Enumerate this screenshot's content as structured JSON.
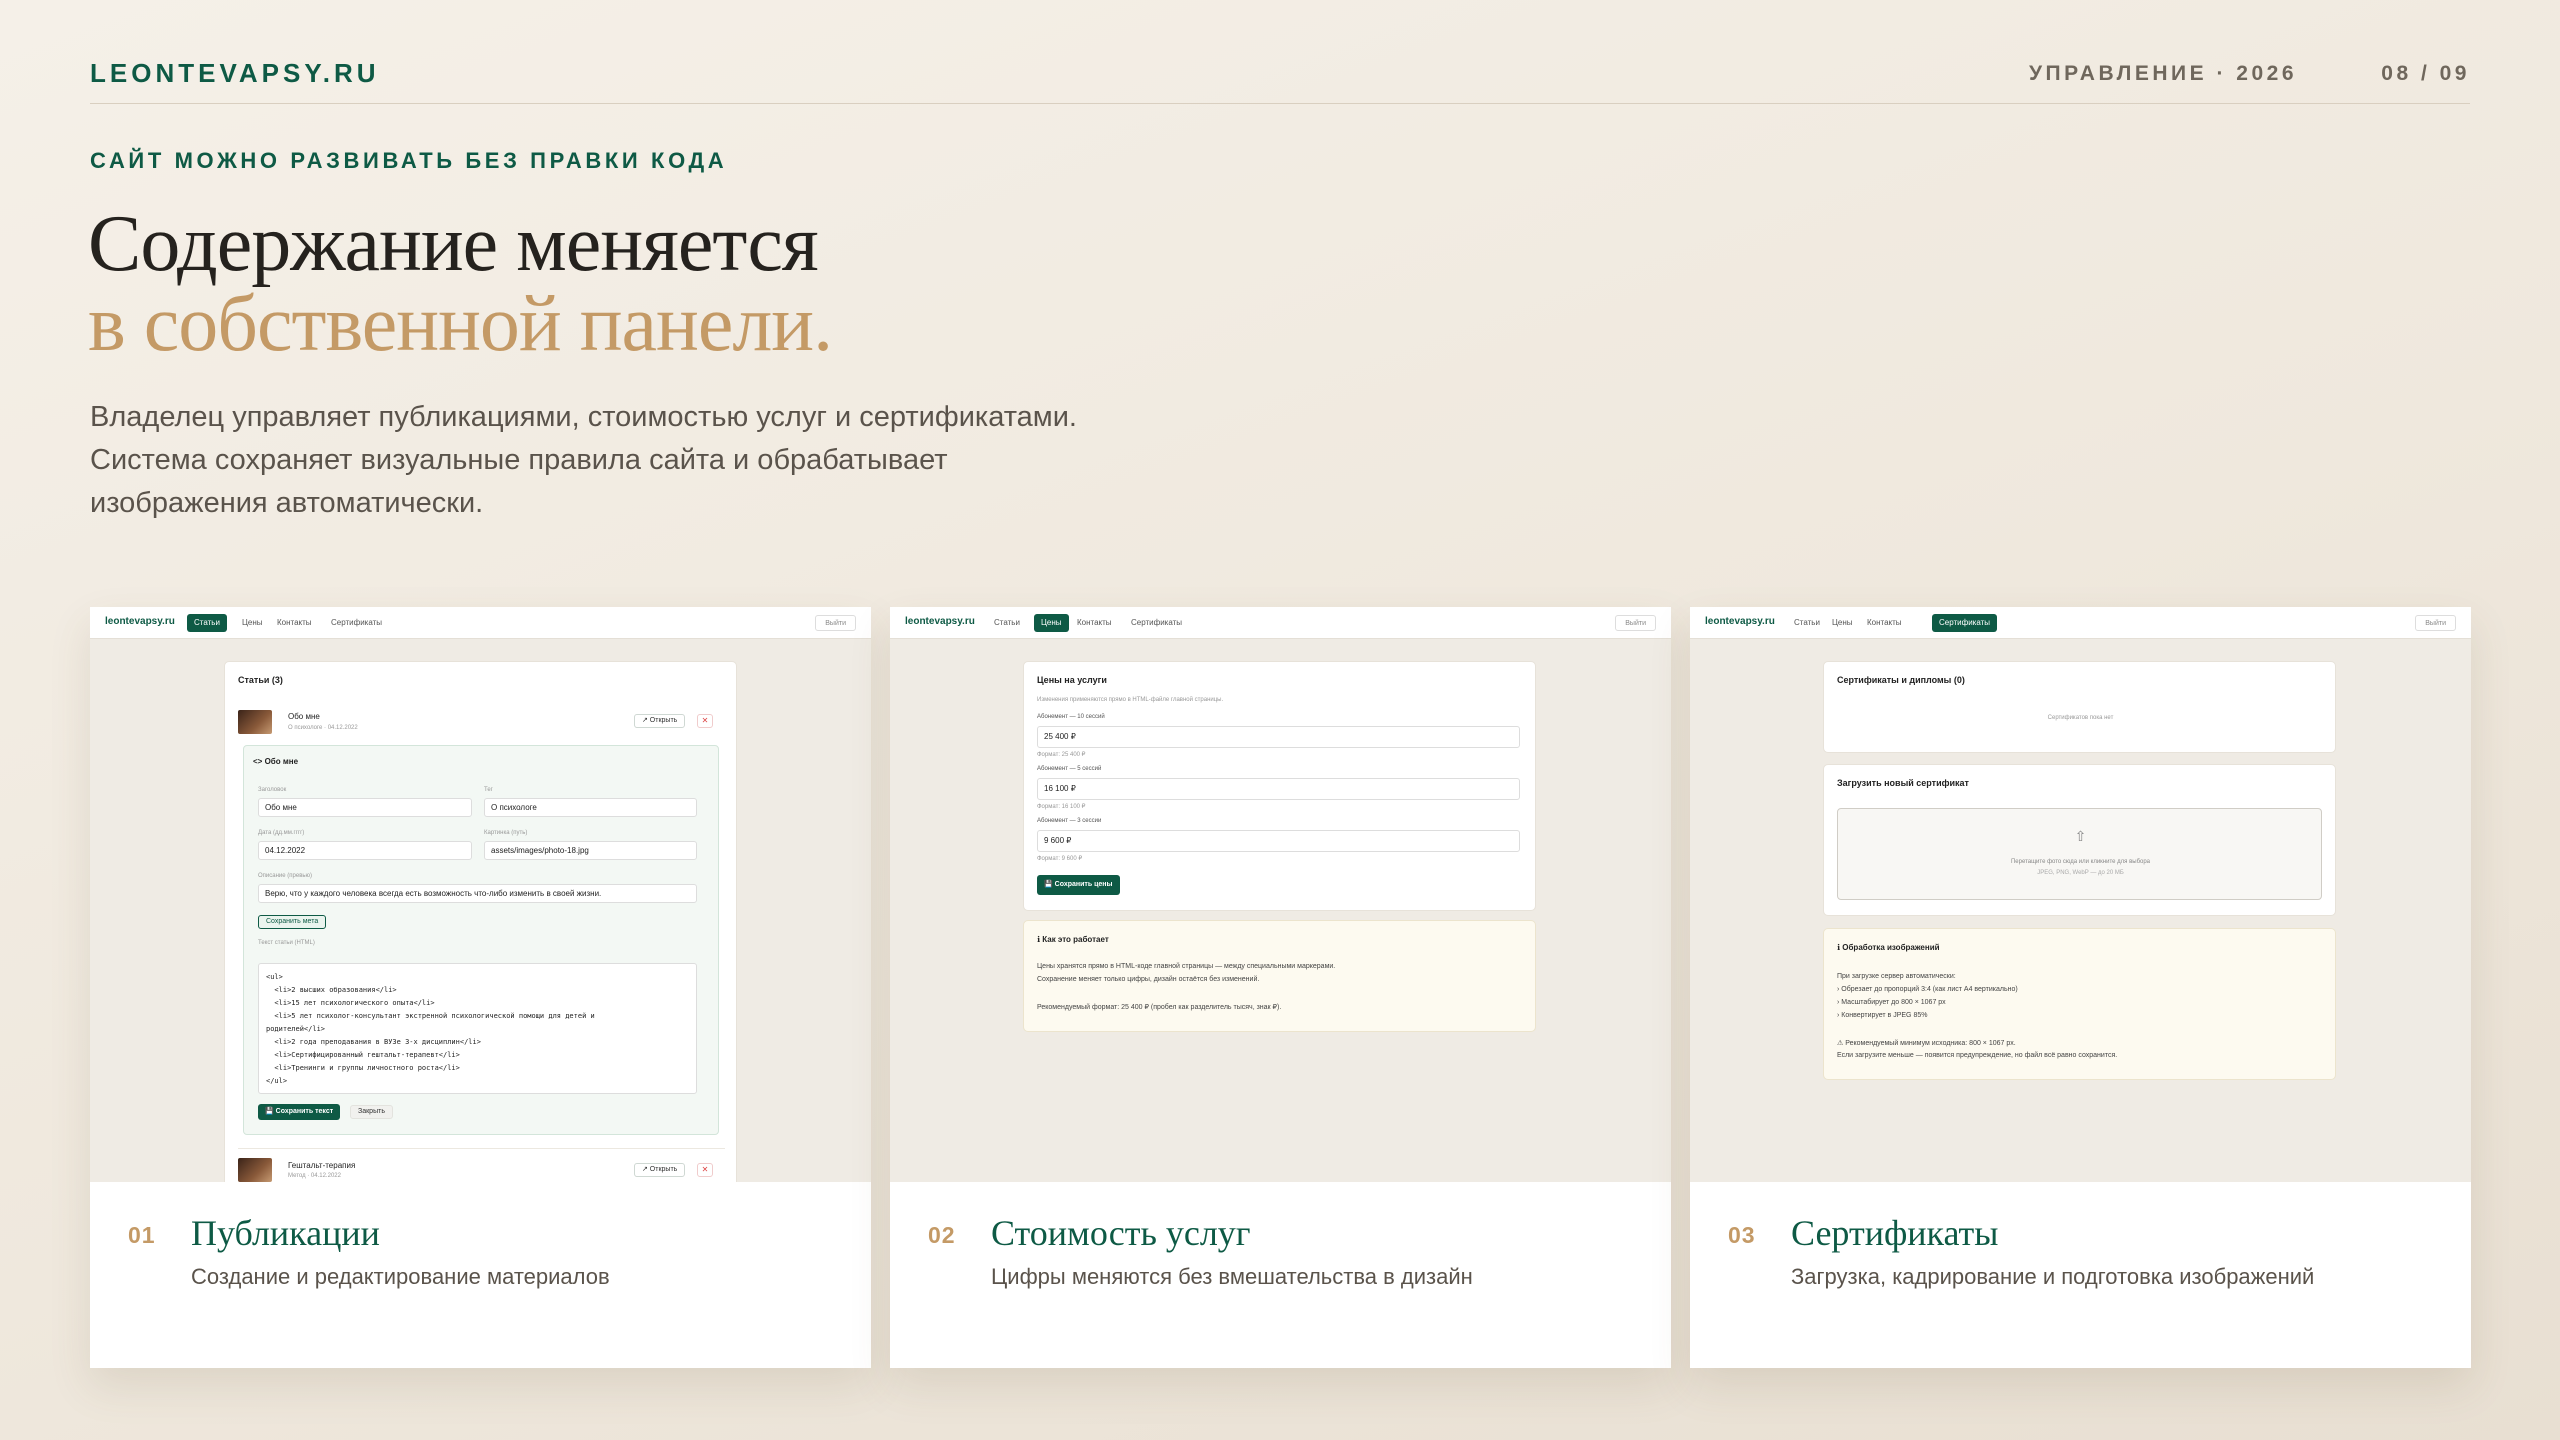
{
  "header": {
    "brand": "LEONTEVAPSY.RU",
    "section": "УПРАВЛЕНИЕ · 2026",
    "pager": "08 / 09"
  },
  "hero": {
    "kicker": "САЙТ МОЖНО РАЗВИВАТЬ БЕЗ ПРАВКИ КОДА",
    "title_line1": "Содержание меняется",
    "title_line2": "в собственной панели.",
    "lede": [
      "Владелец управляет публикациями, стоимостью услуг и сертификатами.",
      "Система сохраняет визуальные правила сайта и обрабатывает",
      "изображения автоматически."
    ]
  },
  "colors": {
    "accent_green": "#0e5a45",
    "accent_gold": "#c49a66"
  },
  "admin_nav": {
    "brand": "leontevapsy.ru",
    "items": [
      "Статьи",
      "Цены",
      "Контакты",
      "Сертификаты"
    ],
    "exit": "Выйти"
  },
  "cards": [
    {
      "num": "01",
      "title": "Публикации",
      "subtitle": "Создание и редактирование материалов",
      "active_tab": 0,
      "articles_header": "Статьи (3)",
      "article1": {
        "title": "Обо мне",
        "meta": "О психологе · 04.12.2022"
      },
      "open_btn": "↗ Открыть",
      "close_icon": "✕",
      "editor": {
        "heading": "<> Обо мне",
        "title_label": "Заголовок",
        "title_value": "Обо мне",
        "tag_label": "Тег",
        "tag_value": "О психологе",
        "date_label": "Дата (дд.мм.гггг)",
        "date_value": "04.12.2022",
        "image_label": "Картинка (путь)",
        "image_value": "assets/images/photo-18.jpg",
        "desc_label": "Описание (превью)",
        "desc_value": "Верю, что у каждого человека всегда есть возможность что-либо изменить в своей жизни.",
        "save_meta": "Сохранить мета",
        "html_label": "Текст статьи (HTML)",
        "html_code": "<ul>\n  <li>2 высших образования</li>\n  <li>15 лет психологического опыта</li>\n  <li>5 лет психолог-консультант экстренной психологической помощи для детей и\nродителей</li>\n  <li>2 года преподавания в ВУЗе 3-х дисциплин</li>\n  <li>Сертифицированный гештальт-терапевт</li>\n  <li>Тренинги и группы личностного роста</li>\n</ul>",
        "save_text": "💾 Сохранить текст",
        "close": "Закрыть"
      },
      "article2": {
        "title": "Гештальт-терапия",
        "meta": "Метод · 04.12.2022"
      }
    },
    {
      "num": "02",
      "title": "Стоимость услуг",
      "subtitle": "Цифры меняются без вмешательства в дизайн",
      "active_tab": 1,
      "prices_header": "Цены на услуги",
      "prices_note": "Изменения применяются прямо в HTML-файле главной страницы.",
      "prices": [
        {
          "label": "Абонемент — 10 сессий",
          "value": "25 400 ₽",
          "hint": "Формат: 25 400 ₽"
        },
        {
          "label": "Абонемент — 5 сессий",
          "value": "16 100 ₽",
          "hint": "Формат: 16 100 ₽"
        },
        {
          "label": "Абонемент — 3 сессии",
          "value": "9 600 ₽",
          "hint": "Формат: 9 600 ₽"
        }
      ],
      "save_prices": "💾 Сохранить цены",
      "how_title": "ℹ Как это работает",
      "how_lines": [
        "Цены хранятся прямо в HTML-коде главной страницы — между специальными маркерами.",
        "Сохранение меняет только цифры, дизайн остаётся без изменений.",
        "Рекомендуемый формат: 25 400 ₽ (пробел как разделитель тысяч, знак ₽)."
      ]
    },
    {
      "num": "03",
      "title": "Сертификаты",
      "subtitle": "Загрузка, кадрирование и подготовка изображений",
      "active_tab": 3,
      "certs_header": "Сертификаты и дипломы (0)",
      "certs_empty": "Сертификатов пока нет",
      "upload_header": "Загрузить новый сертификат",
      "upload_hint": "Перетащите фото сюда или кликните для выбора",
      "upload_formats": "JPEG, PNG, WebP — до 20 МБ",
      "proc_title": "ℹ Обработка изображений",
      "proc_lines": [
        "При загрузке сервер автоматически:",
        "› Обрезает до пропорций 3:4 (как лист А4 вертикально)",
        "› Масштабирует до 800 × 1067 px",
        "› Конвертирует в JPEG 85%",
        "⚠ Рекомендуемый минимум исходника: 800 × 1067 px.",
        "Если загрузите меньше — появится предупреждение, но файл всё равно сохранится."
      ]
    }
  ]
}
